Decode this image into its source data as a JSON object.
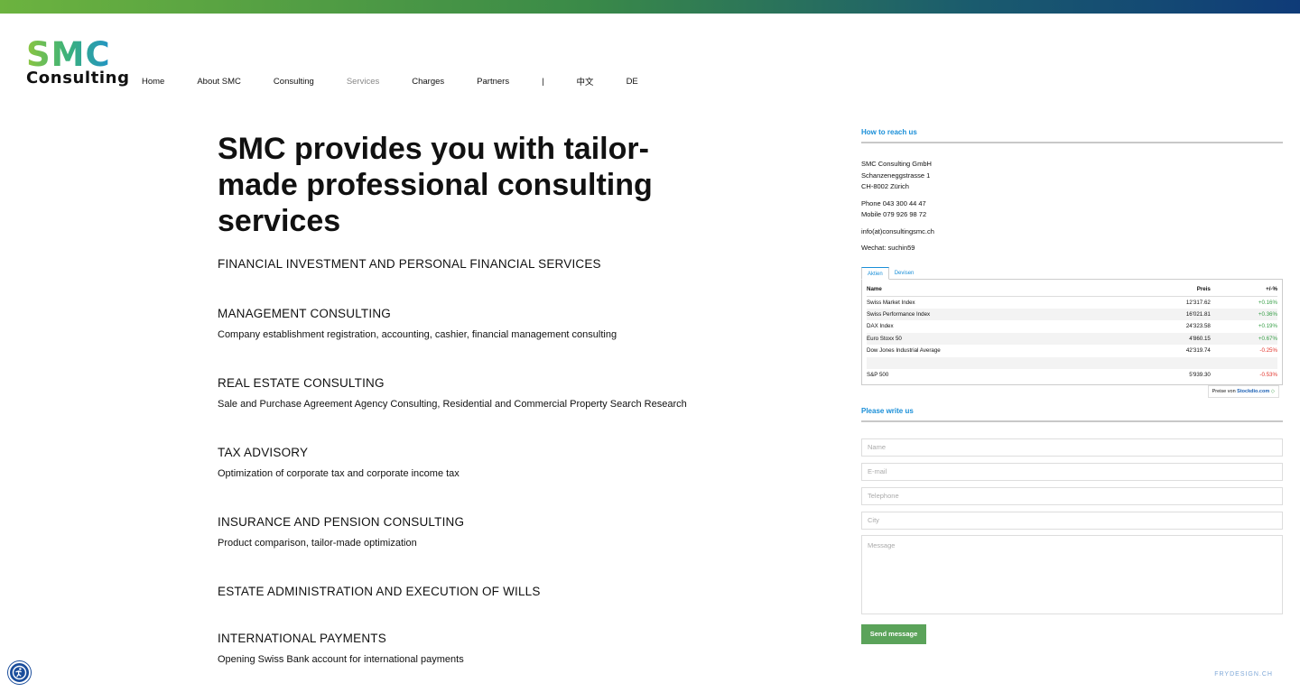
{
  "brand": {
    "logo_top": "SMC",
    "logo_bottom": "Consulting"
  },
  "nav": {
    "items": [
      {
        "label": "Home"
      },
      {
        "label": "About SMC"
      },
      {
        "label": "Consulting"
      },
      {
        "label": "Services"
      },
      {
        "label": "Charges"
      },
      {
        "label": "Partners"
      },
      {
        "label": "|"
      },
      {
        "label": "中文"
      },
      {
        "label": "DE"
      }
    ]
  },
  "main": {
    "title": "SMC provides you with tailor-made professional consulting services",
    "subtitle": "FINANCIAL INVESTMENT AND PERSONAL FINANCIAL SERVICES",
    "sections": [
      {
        "heading": "MANAGEMENT CONSULTING",
        "text": "Company establishment registration, accounting, cashier, financial management consulting"
      },
      {
        "heading": "REAL ESTATE CONSULTING",
        "text": "Sale and Purchase Agreement Agency Consulting, Residential and Commercial Property Search Research"
      },
      {
        "heading": "TAX ADVISORY",
        "text": "Optimization of corporate tax and corporate income tax"
      },
      {
        "heading": "INSURANCE AND PENSION CONSULTING",
        "text": "Product comparison, tailor-made optimization"
      },
      {
        "heading": "ESTATE ADMINISTRATION AND EXECUTION OF WILLS",
        "text": ""
      },
      {
        "heading": "INTERNATIONAL PAYMENTS",
        "text": "Opening Swiss Bank account for international payments"
      }
    ]
  },
  "aside": {
    "reach_title": "How to reach us",
    "company": "SMC Consulting GmbH",
    "street": "Schanzeneggstrasse 1",
    "city": "CH-8002 Zürich",
    "phone": "Phone 043 300 44 47",
    "mobile": "Mobile 079 926 98 72",
    "email": "info(at)consultingsmc.ch",
    "wechat": "Wechat: suchin59",
    "widget": {
      "tabs": [
        "Aktien",
        "Devisen"
      ],
      "headers": [
        "Name",
        "Preis",
        "+/-%"
      ],
      "rows": [
        {
          "name": "Swiss Market Index",
          "price": "12'317.62",
          "change": "+0.16%"
        },
        {
          "name": "Swiss Performance Index",
          "price": "16'021.81",
          "change": "+0.36%"
        },
        {
          "name": "DAX Index",
          "price": "24'323.58",
          "change": "+0.19%"
        },
        {
          "name": "Euro Stoxx 50",
          "price": "4'860.15",
          "change": "+0.67%"
        },
        {
          "name": "Dow Jones Industrial Average",
          "price": "42'319.74",
          "change": "-0.25%"
        },
        {
          "name": "",
          "price": "",
          "change": ""
        },
        {
          "name": "S&P 500",
          "price": "5'939.30",
          "change": "-0.53%"
        }
      ],
      "powered_prefix": "Preise von",
      "powered_brand": "Stockdio.com"
    },
    "write_title": "Please write us",
    "form": {
      "name_placeholder": "Name",
      "email_placeholder": "E-mail",
      "telephone_placeholder": "Telephone",
      "city_placeholder": "City",
      "message_placeholder": "Message",
      "submit_label": "Send message"
    }
  },
  "footer": {
    "credit": "FRYDESIGN.CH"
  },
  "colors": {
    "accent_blue": "#1a8fd8",
    "button_green": "#5ba35a",
    "positive": "#3aa14a",
    "negative": "#e2342b"
  }
}
